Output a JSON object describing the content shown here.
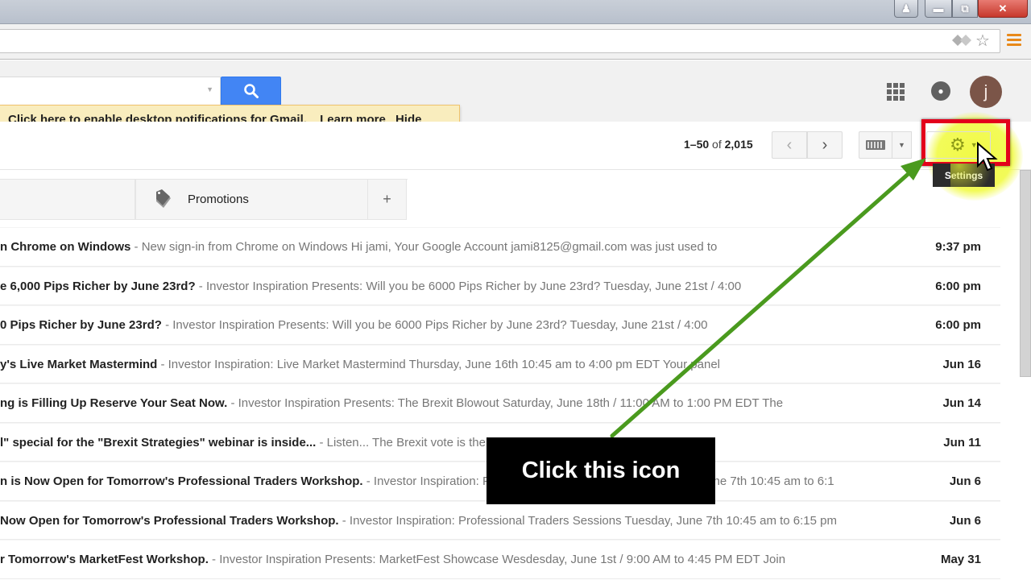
{
  "window": {
    "buttons": [
      "user",
      "minimize",
      "maximize",
      "close"
    ]
  },
  "addressbar": {
    "icons": [
      "translate-icon",
      "bookmark-star-icon",
      "chrome-menu-icon"
    ]
  },
  "gbar": {
    "search_value": "",
    "icons": [
      "search-icon",
      "apps-grid-icon",
      "notifications-bell-icon"
    ],
    "avatar_letter": "j"
  },
  "notification": {
    "enable_link": "Click here to enable",
    "message": " desktop notifications for Gmail.",
    "learn_more": "Learn more",
    "hide": "Hide"
  },
  "toolbar": {
    "range": "1–50",
    "of": " of ",
    "total": "2,015",
    "prev_glyph": "‹",
    "next_glyph": "›",
    "settings_tooltip": "Settings"
  },
  "tabs": [
    {
      "label": ""
    },
    {
      "label": "Promotions"
    },
    {
      "label": "+"
    }
  ],
  "emails": [
    {
      "subject": "n Chrome on Windows",
      "snippet": " - New sign-in from Chrome on Windows Hi jami, Your Google Account jami8125@gmail.com was just used to",
      "date": "9:37 pm"
    },
    {
      "subject": "e 6,000 Pips Richer by June 23rd?",
      "snippet": " - Investor Inspiration Presents: Will you be 6000 Pips Richer by June 23rd? Tuesday, June 21st / 4:00",
      "date": "6:00 pm"
    },
    {
      "subject": "0 Pips Richer by June 23rd?",
      "snippet": " - Investor Inspiration Presents: Will you be 6000 Pips Richer by June 23rd? Tuesday, June 21st / 4:00",
      "date": "6:00 pm"
    },
    {
      "subject": "y's Live Market Mastermind",
      "snippet": " - Investor Inspiration: Live Market Mastermind Thursday, June 16th 10:45 am to 4:00 pm EDT Your panel",
      "date": "Jun 16"
    },
    {
      "subject": "ng is Filling Up Reserve Your Seat Now.",
      "snippet": " - Investor Inspiration Presents: The Brexit Blowout Saturday, June 18th / 11:00 AM to 1:00 PM EDT The",
      "date": "Jun 14"
    },
    {
      "subject": "l\" special for the \"Brexit Strategies\" webinar is inside...",
      "snippet": " - Listen... The Brexit vote is the biggest trading opportunity I've seen in the",
      "date": "Jun 11"
    },
    {
      "subject": "n is Now Open for Tomorrow's Professional Traders Workshop.",
      "snippet": " - Investor Inspiration: Professional Traders Sessions Tuesday, June 7th 10:45 am to 6:1",
      "date": "Jun 6"
    },
    {
      "subject": "Now Open for Tomorrow's Professional Traders Workshop.",
      "snippet": " - Investor Inspiration: Professional Traders Sessions Tuesday, June 7th 10:45 am to 6:15 pm",
      "date": "Jun 6"
    },
    {
      "subject": "r Tomorrow's MarketFest Workshop.",
      "snippet": " - Investor Inspiration Presents: MarketFest Showcase Wesdesday, June 1st / 9:00 AM to 4:45 PM EDT Join",
      "date": "May 31"
    }
  ],
  "annotation": {
    "callout": "Click this icon",
    "arrow_color": "#4a9a1e",
    "box_color": "#e3001b",
    "highlight_color": "#f0fa3c"
  }
}
